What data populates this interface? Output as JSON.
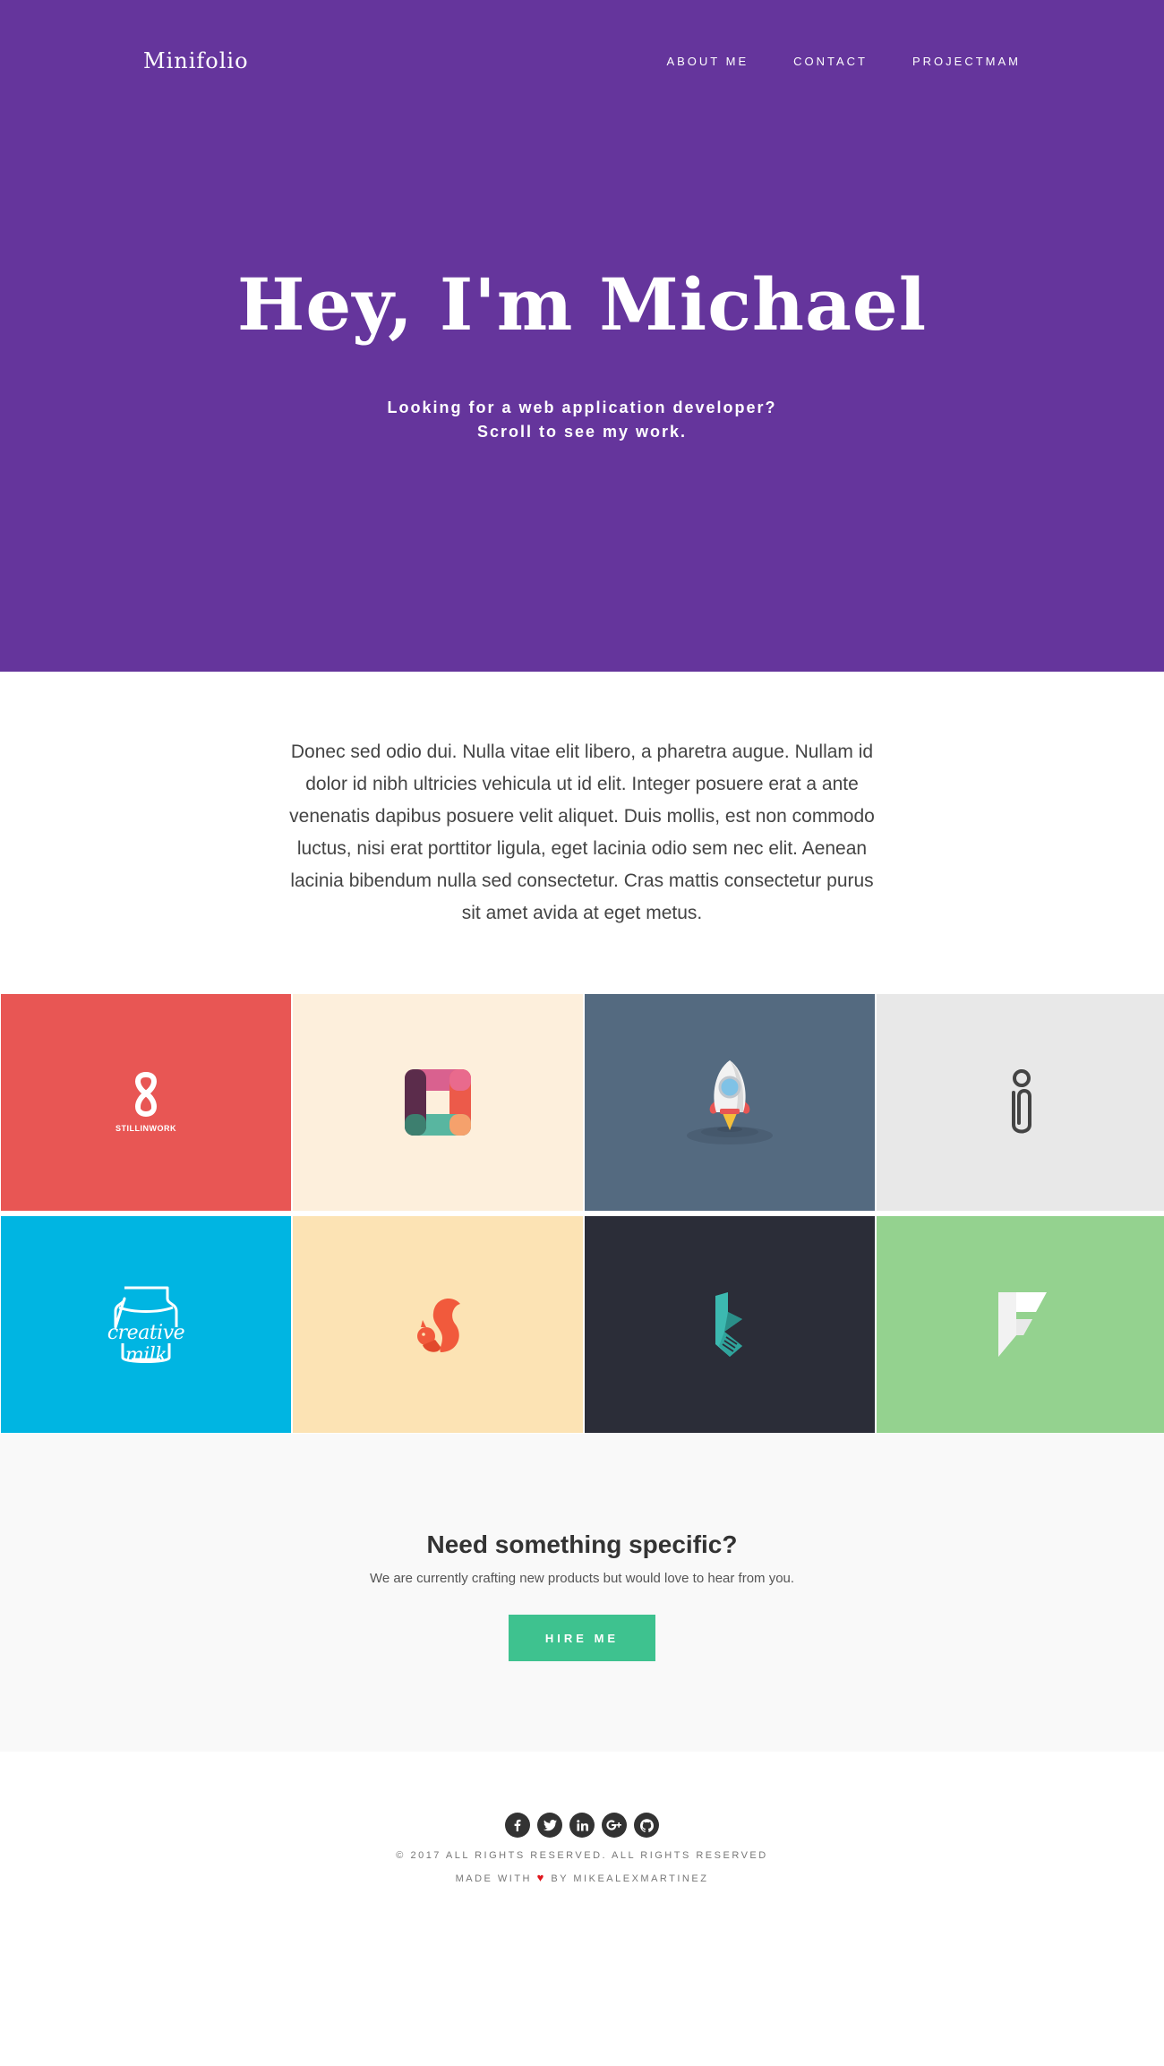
{
  "header": {
    "brand": "Minifolio",
    "nav": [
      "ABOUT ME",
      "CONTACT",
      "PROJECTMAM"
    ]
  },
  "hero": {
    "title": "Hey, I'm Michael",
    "subtitle_line1": "Looking for a web application developer?",
    "subtitle_line2": "Scroll to see my work."
  },
  "intro": {
    "text": "Donec sed odio dui. Nulla vitae elit libero, a pharetra augue. Nullam id dolor id nibh ultricies vehicula ut id elit. Integer posuere erat a ante venenatis dapibus posuere velit aliquet. Duis mollis, est non commodo luctus, nisi erat porttitor ligula, eget lacinia odio sem nec elit. Aenean lacinia bibendum nulla sed consectetur. Cras mattis consectetur purus sit amet avida at eget metus."
  },
  "portfolio": [
    {
      "bg": "#e85654",
      "icon": "stillinwork-logo",
      "label": "STILLINWORK"
    },
    {
      "bg": "#fdefdc",
      "icon": "square-ring-logo"
    },
    {
      "bg": "#546a80",
      "icon": "rocket-icon"
    },
    {
      "bg": "#e8e8e8",
      "icon": "paperclip-person-icon"
    },
    {
      "bg": "#00b5e2",
      "icon": "creative-milk-logo",
      "label": "creative milk"
    },
    {
      "bg": "#fce3b4",
      "icon": "squirrel-icon"
    },
    {
      "bg": "#2b2d38",
      "icon": "k-mark-logo"
    },
    {
      "bg": "#94d28f",
      "icon": "f-mark-logo"
    }
  ],
  "cta": {
    "title": "Need something specific?",
    "text": "We are currently crafting new products but would love to hear from you.",
    "button": "HIRE ME",
    "button_color": "#3ec28f"
  },
  "footer": {
    "social": [
      "facebook-icon",
      "twitter-icon",
      "linkedin-icon",
      "google-plus-icon",
      "github-icon"
    ],
    "copyright": "© 2017 ALL RIGHTS RESERVED. ALL RIGHTS RESERVED",
    "made_prefix": "MADE WITH",
    "made_suffix": "BY MIKEALEXMARTINEZ"
  },
  "colors": {
    "hero_bg": "#65359c",
    "cta_bg": "#f9f9f9",
    "heart": "#e0161d"
  }
}
